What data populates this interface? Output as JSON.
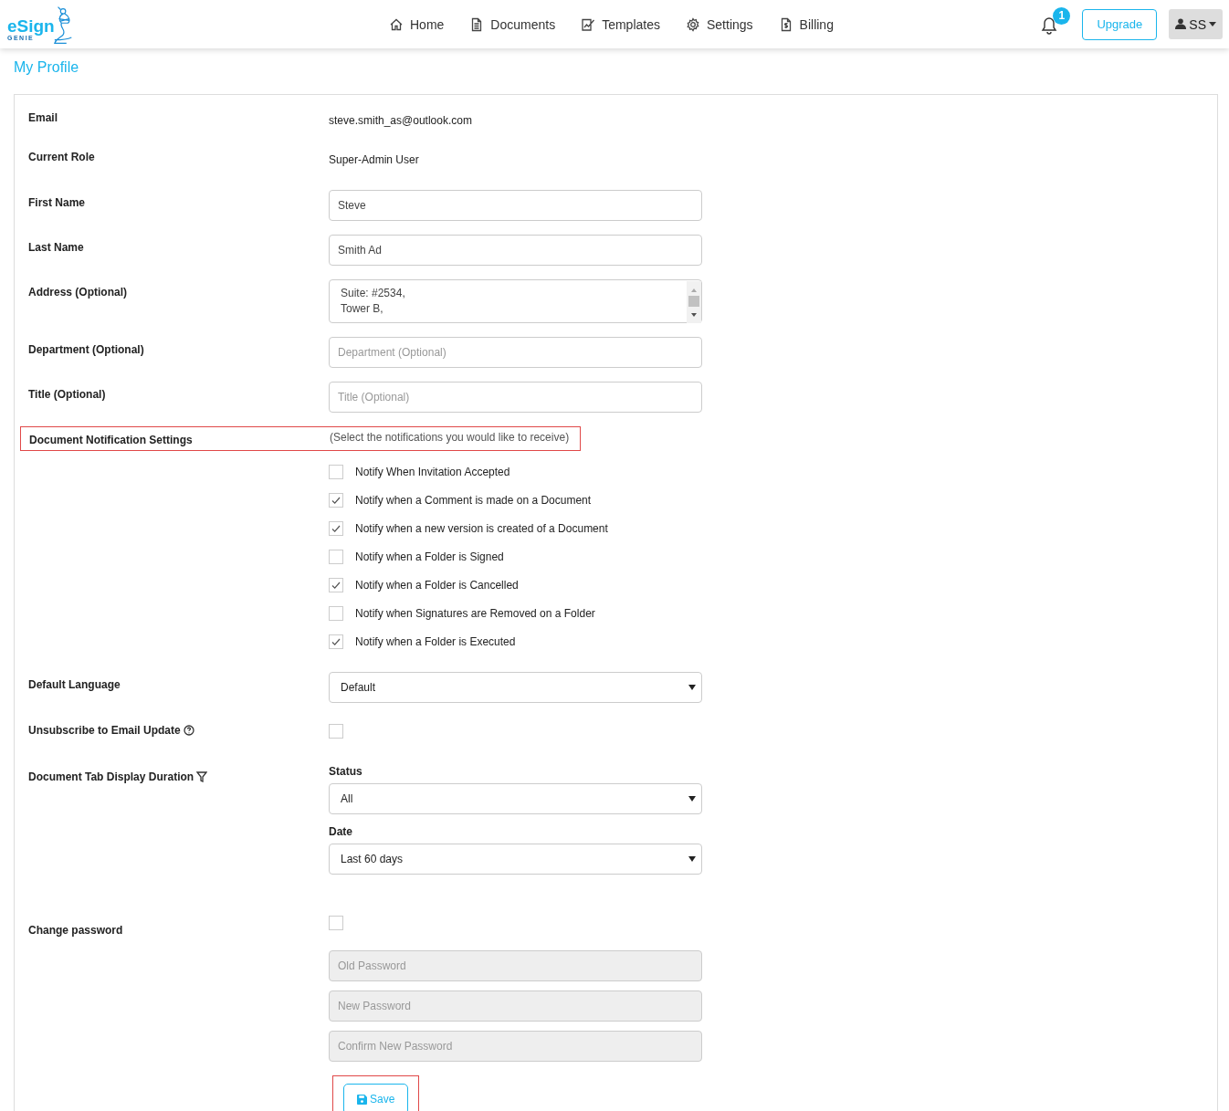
{
  "brand": {
    "name": "eSign",
    "sub": "GENIE"
  },
  "nav": [
    {
      "label": "Home"
    },
    {
      "label": "Documents"
    },
    {
      "label": "Templates"
    },
    {
      "label": "Settings"
    },
    {
      "label": "Billing"
    }
  ],
  "notifications_badge": "1",
  "upgrade_button": "Upgrade",
  "user_menu": "SS",
  "page_title": "My Profile",
  "rows": [
    {
      "kind": "static",
      "label": "Email",
      "value": "steve.smith_as@outlook.com"
    },
    {
      "kind": "static",
      "label": "Current Role",
      "value": "Super-Admin User"
    },
    {
      "kind": "input",
      "label": "First Name",
      "value": "Steve"
    },
    {
      "kind": "input",
      "label": "Last Name",
      "value": "Smith Ad"
    },
    {
      "kind": "textarea",
      "label": "Address (Optional)",
      "value": "Suite: #2534,\nTower B,"
    },
    {
      "kind": "input",
      "label": "Department (Optional)",
      "placeholder": "Department (Optional)"
    },
    {
      "kind": "input",
      "label": "Title (Optional)",
      "placeholder": "Title (Optional)"
    },
    {
      "kind": "notifications",
      "label": "Document Notification Settings",
      "hint": "(Select the notifications you would like to receive)",
      "highlighted": true,
      "options": [
        {
          "label": "Notify When Invitation Accepted",
          "checked": false
        },
        {
          "label": "Notify when a Comment is made on a Document",
          "checked": true
        },
        {
          "label": "Notify when a new version is created of a Document",
          "checked": true
        },
        {
          "label": "Notify when a Folder is Signed",
          "checked": false
        },
        {
          "label": "Notify when a Folder is Cancelled",
          "checked": true
        },
        {
          "label": "Notify when Signatures are Removed on a Folder",
          "checked": false
        },
        {
          "label": "Notify when a Folder is Executed",
          "checked": true
        }
      ]
    },
    {
      "kind": "select",
      "label": "Default Language",
      "value": "Default"
    },
    {
      "kind": "checkbox",
      "label": "Unsubscribe to Email Update",
      "checked": false
    },
    {
      "kind": "filters",
      "label": "Document Tab Display Duration",
      "filters": [
        {
          "label": "Status",
          "value": "All"
        },
        {
          "label": "Date",
          "value": "Last 60 days"
        }
      ]
    },
    {
      "kind": "password",
      "label": "Change password",
      "checked": false,
      "fields": [
        {
          "placeholder": "Old Password"
        },
        {
          "placeholder": "New Password"
        },
        {
          "placeholder": "Confirm New Password"
        }
      ]
    }
  ],
  "save_button": {
    "label": "Save",
    "highlighted": true
  }
}
